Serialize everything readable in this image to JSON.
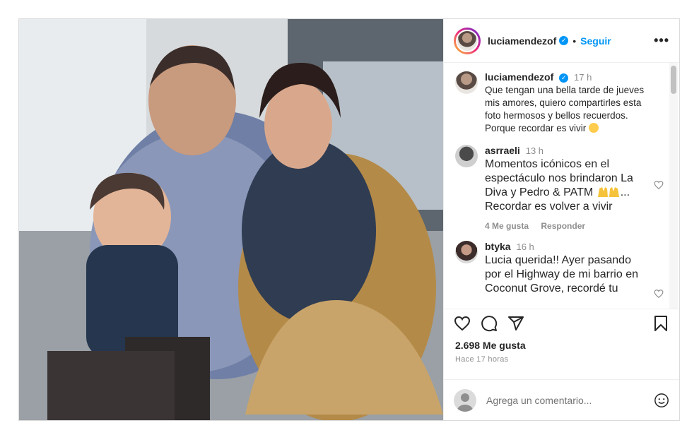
{
  "post": {
    "username": "luciamendezof",
    "follow_label": "Seguir",
    "more_label": "•••",
    "caption": {
      "username": "luciamendezof",
      "time": "17 h",
      "text": "Que tengan una bella tarde de jueves mis amores, quiero compartirles esta foto hermosos y bellos recuerdos. Porque recordar es vivir"
    },
    "comments": [
      {
        "username": "asrraeli",
        "time": "13 h",
        "text_before": "Momentos icónicos en el espectáculo nos brindaron La Diva y Pedro & PATM",
        "text_after": "... Recordar es volver a vivir",
        "likes": "4 Me gusta",
        "reply": "Responder"
      },
      {
        "username": "btyka",
        "time": "16 h",
        "text": "Lucia querida!! Ayer pasando por el Highway de mi barrio en Coconut Grove, recordé tu"
      }
    ],
    "likes_count": "2.698 Me gusta",
    "time_ago": "Hace 17 horas",
    "comment_placeholder": "Agrega un comentario...",
    "icons": {
      "like": "heart-icon",
      "comment": "comment-icon",
      "share": "share-icon",
      "save": "bookmark-icon",
      "emoji": "emoji-icon"
    }
  }
}
